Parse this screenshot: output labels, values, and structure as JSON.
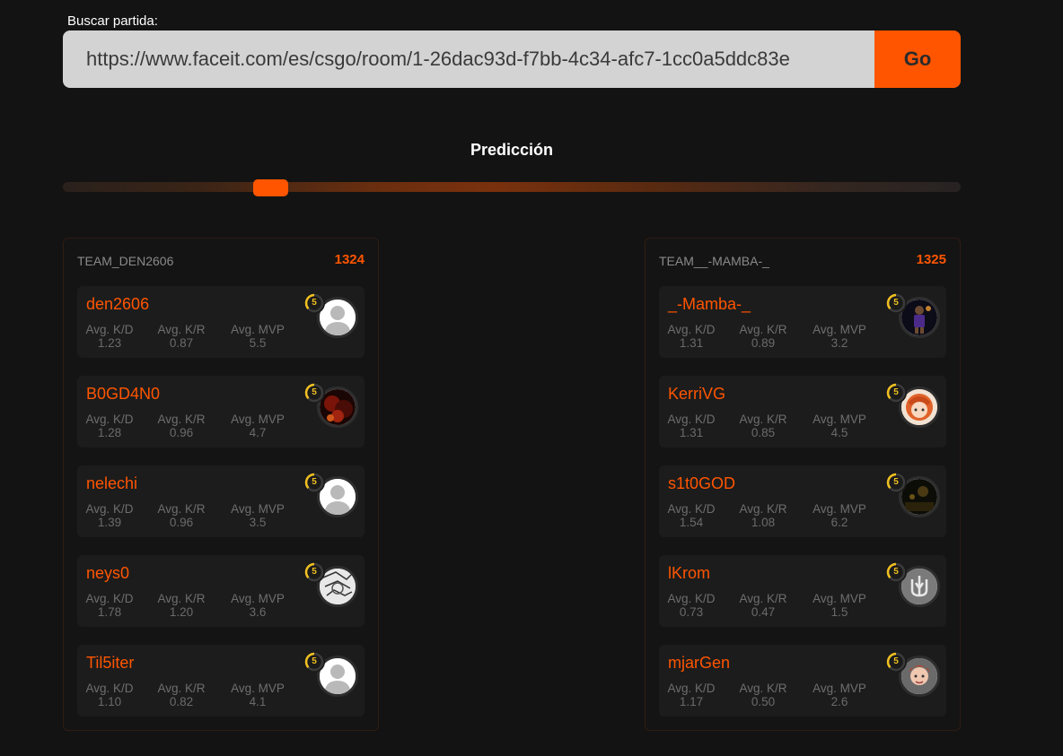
{
  "search": {
    "label": "Buscar partida:",
    "value": "https://www.faceit.com/es/csgo/room/1-26dac93d-f7bb-4c34-afc7-1cc0a5ddc83e",
    "button": "Go"
  },
  "prediction": {
    "title": "Predicción",
    "slider_value": 0.24
  },
  "stat_labels": {
    "kd": "Avg. K/D",
    "kr": "Avg. K/R",
    "mvp": "Avg. MVP"
  },
  "colors": {
    "accent": "#ff5500",
    "level": "#f0c020"
  },
  "teams": [
    {
      "name": "TEAM_DEN2606",
      "elo": "1324",
      "players": [
        {
          "name": "den2606",
          "kd": "1.23",
          "kr": "0.87",
          "mvp": "5.5",
          "level": "5",
          "avatar": "default-avatar-icon"
        },
        {
          "name": "B0GD4N0",
          "kd": "1.28",
          "kr": "0.96",
          "mvp": "4.7",
          "level": "5",
          "avatar": "user-photo-dark-red"
        },
        {
          "name": "nelechi",
          "kd": "1.39",
          "kr": "0.96",
          "mvp": "3.5",
          "level": "5",
          "avatar": "default-avatar-icon"
        },
        {
          "name": "neys0",
          "kd": "1.78",
          "kr": "1.20",
          "mvp": "3.6",
          "level": "5",
          "avatar": "manga-sketch-avatar"
        },
        {
          "name": "Til5iter",
          "kd": "1.10",
          "kr": "0.82",
          "mvp": "4.1",
          "level": "5",
          "avatar": "default-avatar-icon"
        }
      ]
    },
    {
      "name": "TEAM__-MAMBA-_",
      "elo": "1325",
      "players": [
        {
          "name": "_-Mamba-_",
          "kd": "1.31",
          "kr": "0.89",
          "mvp": "3.2",
          "level": "5",
          "avatar": "basketball-player-avatar"
        },
        {
          "name": "KerriVG",
          "kd": "1.31",
          "kr": "0.85",
          "mvp": "4.5",
          "level": "5",
          "avatar": "anime-girl-avatar"
        },
        {
          "name": "s1t0GOD",
          "kd": "1.54",
          "kr": "1.08",
          "mvp": "6.2",
          "level": "5",
          "avatar": "dark-scene-avatar"
        },
        {
          "name": "lKrom",
          "kd": "0.73",
          "kr": "0.47",
          "mvp": "1.5",
          "level": "5",
          "avatar": "trident-emblem-avatar"
        },
        {
          "name": "mjarGen",
          "kd": "1.17",
          "kr": "0.50",
          "mvp": "2.6",
          "level": "5",
          "avatar": "user-photo-red-hair"
        }
      ]
    }
  ]
}
